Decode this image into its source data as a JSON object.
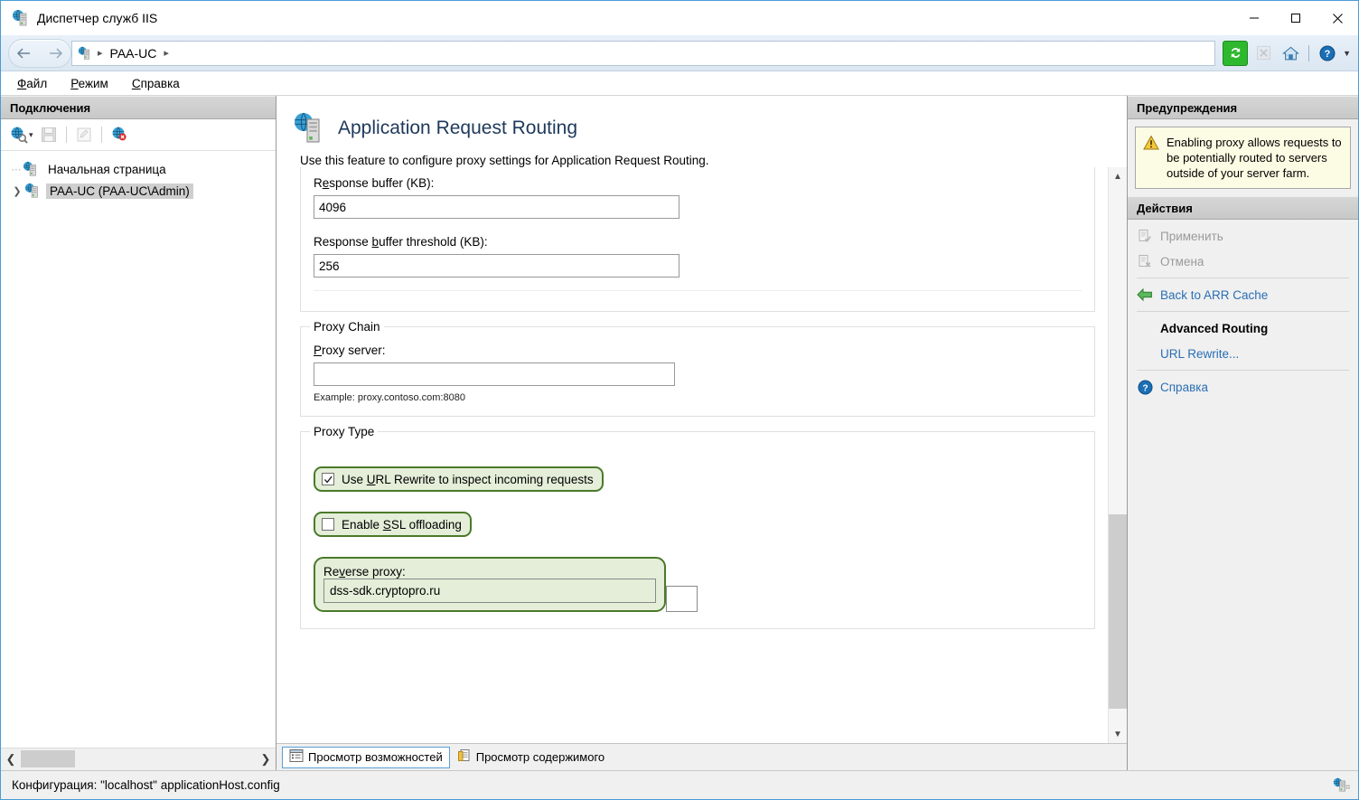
{
  "window": {
    "title": "Диспетчер служб IIS",
    "icon": "iis-server-icon",
    "controls": {
      "minimize": "minimize-icon",
      "maximize": "maximize-icon",
      "close": "close-icon"
    }
  },
  "addressbar": {
    "back": "back-arrow-icon",
    "forward": "forward-arrow-icon",
    "crumb_icon": "server-icon",
    "crumbs": [
      "PAA-UC"
    ],
    "separator": "▸",
    "tools": [
      {
        "name": "refresh-icon",
        "label": "Обновить",
        "enabled": true
      },
      {
        "name": "stop-icon",
        "label": "Остановить",
        "enabled": false
      },
      {
        "name": "home-icon",
        "label": "Начальная страница",
        "enabled": true
      },
      {
        "name": "help-icon",
        "label": "Справка",
        "enabled": true
      }
    ],
    "dropdown_caret": "▼"
  },
  "menubar": {
    "items": [
      {
        "prefix": "",
        "accel": "Ф",
        "rest": "айл"
      },
      {
        "prefix": "",
        "accel": "Р",
        "rest": "ежим"
      },
      {
        "prefix": "",
        "accel": "С",
        "rest": "правка"
      }
    ]
  },
  "connections": {
    "header": "Подключения",
    "toolbar": [
      {
        "name": "connect-to-icon",
        "enabled": true
      },
      {
        "name": "save-icon",
        "enabled": false
      },
      {
        "name": "edit-connection-icon",
        "enabled": false
      },
      {
        "name": "disconnect-icon",
        "enabled": true
      }
    ],
    "tree": [
      {
        "label": "Начальная страница",
        "icon": "start-page-icon",
        "selected": false,
        "expandable": false
      },
      {
        "label": "PAA-UC (PAA-UC\\Admin)",
        "icon": "server-node-icon",
        "selected": true,
        "expandable": true,
        "expander": "❯"
      }
    ],
    "hscroll": {
      "left_arrow": "❮",
      "right_arrow": "❯"
    }
  },
  "feature": {
    "icon": "arr-feature-icon",
    "title": "Application Request Routing",
    "description": "Use this feature to configure proxy settings for Application Request Routing.",
    "fields": [
      {
        "label_prefix": "R",
        "label_accel": "e",
        "label_rest": "sponse buffer (KB):",
        "label_full": "Response buffer (KB):",
        "value": "4096",
        "name": "response-buffer"
      },
      {
        "label_prefix": "Response ",
        "label_accel": "b",
        "label_rest": "uffer threshold (KB):",
        "label_full": "Response buffer threshold (KB):",
        "value": "256",
        "name": "response-buffer-threshold"
      }
    ],
    "proxy_chain": {
      "legend": "Proxy Chain",
      "label_prefix": "",
      "label_accel": "P",
      "label_rest": "roxy server:",
      "label_full": "Proxy server:",
      "value": "",
      "example": "Example: proxy.contoso.com:8080"
    },
    "proxy_type": {
      "legend": "Proxy Type",
      "checkboxes": [
        {
          "name": "use-url-rewrite-checkbox",
          "checked": true,
          "prefix": "Use ",
          "accel": "U",
          "rest": "RL Rewrite to inspect incoming requests",
          "full": "Use URL Rewrite to inspect incoming requests",
          "highlighted": true
        },
        {
          "name": "enable-ssl-offloading-checkbox",
          "checked": false,
          "prefix": "Enable ",
          "accel": "S",
          "rest": "SL offloading",
          "full": "Enable SSL offloading",
          "highlighted": true
        }
      ],
      "reverse_proxy": {
        "label_prefix": "Re",
        "label_accel": "v",
        "label_rest": "erse proxy:",
        "label_full": "Reverse proxy:",
        "value": "dss-sdk.cryptopro.ru",
        "highlighted": true
      }
    }
  },
  "tabs": [
    {
      "label": "Просмотр возможностей",
      "icon": "features-view-icon",
      "active": true
    },
    {
      "label": "Просмотр содержимого",
      "icon": "content-view-icon",
      "active": false
    }
  ],
  "right": {
    "alerts_header": "Предупреждения",
    "alert": {
      "icon": "warning-icon",
      "text": "Enabling proxy allows requests to be potentially routed to servers outside of your server farm."
    },
    "actions_header": "Действия",
    "actions": [
      {
        "label": "Применить",
        "icon": "apply-icon",
        "state": "disabled"
      },
      {
        "label": "Отмена",
        "icon": "cancel-icon",
        "state": "disabled"
      },
      {
        "divider": true
      },
      {
        "label": "Back to ARR Cache",
        "icon": "back-green-arrow-icon",
        "state": "link"
      },
      {
        "divider": true
      },
      {
        "label": "Advanced Routing",
        "icon": "",
        "state": "bold-heading"
      },
      {
        "label": "URL Rewrite...",
        "icon": "",
        "state": "link"
      },
      {
        "divider": true
      },
      {
        "label": "Справка",
        "icon": "help-circle-icon",
        "state": "link"
      }
    ]
  },
  "statusbar": {
    "text": "Конфигурация: \"localhost\" applicationHost.config",
    "icon": "config-server-icon"
  },
  "colors": {
    "accent": "#2a6fb5",
    "annotation_border": "#4a7a2a",
    "annotation_fill": "#e4eed8",
    "warn_bg": "#fcfbe3",
    "title_blue": "#1e395b",
    "window_border": "#4a9cd6"
  },
  "scroll": {
    "vertical_position_pct": 72
  }
}
